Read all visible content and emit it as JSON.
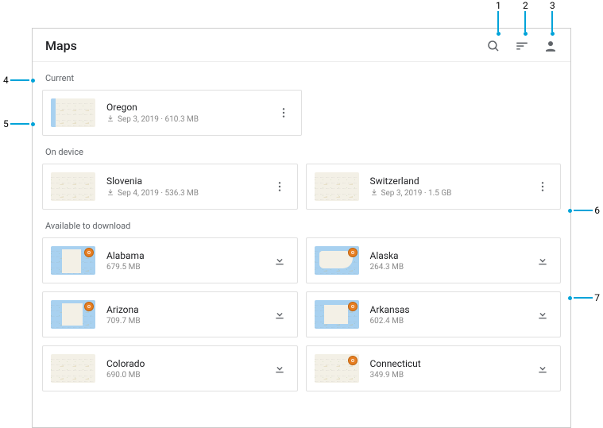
{
  "header": {
    "title": "Maps"
  },
  "sections": {
    "current": {
      "label": "Current"
    },
    "ondevice": {
      "label": "On device"
    },
    "available": {
      "label": "Available to download"
    }
  },
  "current": [
    {
      "name": "Oregon",
      "meta": "Sep 3, 2019 · 610.3 MB"
    }
  ],
  "ondevice": [
    {
      "name": "Slovenia",
      "meta": "Sep 4, 2019 · 536.3 MB"
    },
    {
      "name": "Switzerland",
      "meta": "Sep 3, 2019 · 1.5 GB"
    }
  ],
  "available": [
    {
      "name": "Alabama",
      "meta": "679.5 MB"
    },
    {
      "name": "Alaska",
      "meta": "264.3 MB"
    },
    {
      "name": "Arizona",
      "meta": "709.7 MB"
    },
    {
      "name": "Arkansas",
      "meta": "602.4 MB"
    },
    {
      "name": "Colorado",
      "meta": "690.0 MB"
    },
    {
      "name": "Connecticut",
      "meta": "349.9 MB"
    }
  ],
  "callouts": {
    "c1": "1",
    "c2": "2",
    "c3": "3",
    "c4": "4",
    "c5": "5",
    "c6": "6",
    "c7": "7"
  }
}
